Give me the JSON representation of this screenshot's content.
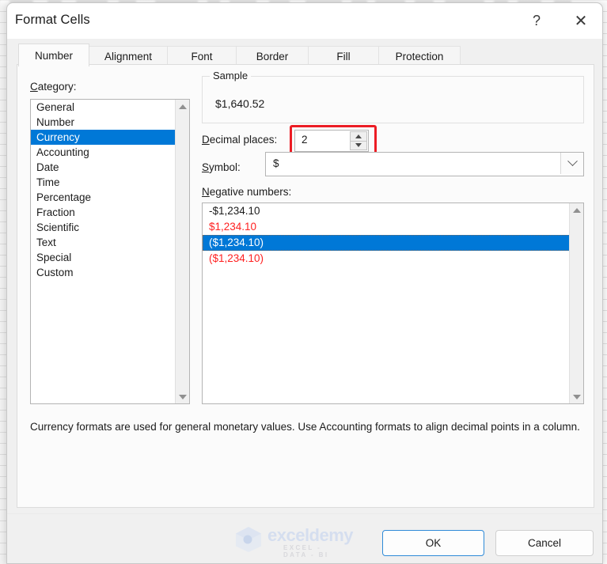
{
  "dialog": {
    "title": "Format Cells",
    "help_icon": "?",
    "close_icon": "✕"
  },
  "tabs": [
    {
      "label": "Number",
      "selected": true
    },
    {
      "label": "Alignment",
      "selected": false
    },
    {
      "label": "Font",
      "selected": false
    },
    {
      "label": "Border",
      "selected": false
    },
    {
      "label": "Fill",
      "selected": false
    },
    {
      "label": "Protection",
      "selected": false
    }
  ],
  "category": {
    "label": "Category:",
    "label_accel": "C",
    "items": [
      {
        "label": "General",
        "selected": false
      },
      {
        "label": "Number",
        "selected": false
      },
      {
        "label": "Currency",
        "selected": true
      },
      {
        "label": "Accounting",
        "selected": false
      },
      {
        "label": "Date",
        "selected": false
      },
      {
        "label": "Time",
        "selected": false
      },
      {
        "label": "Percentage",
        "selected": false
      },
      {
        "label": "Fraction",
        "selected": false
      },
      {
        "label": "Scientific",
        "selected": false
      },
      {
        "label": "Text",
        "selected": false
      },
      {
        "label": "Special",
        "selected": false
      },
      {
        "label": "Custom",
        "selected": false
      }
    ]
  },
  "sample": {
    "legend": "Sample",
    "value": "$1,640.52"
  },
  "decimal_places": {
    "label": "Decimal places:",
    "label_accel": "D",
    "value": "2",
    "highlight_color": "#ec1c24"
  },
  "symbol": {
    "label": "Symbol:",
    "label_accel": "S",
    "value": "$"
  },
  "negative_numbers": {
    "label": "Negative numbers:",
    "label_accel": "N",
    "items": [
      {
        "label": "-$1,234.10",
        "color": "#1b1b1b",
        "selected": false
      },
      {
        "label": "$1,234.10",
        "color": "#ff2020",
        "selected": false
      },
      {
        "label": "($1,234.10)",
        "color": "#1b1b1b",
        "selected": true
      },
      {
        "label": "($1,234.10)",
        "color": "#ff2020",
        "selected": false
      }
    ]
  },
  "description": "Currency formats are used for general monetary values.  Use Accounting formats to align decimal points in a column.",
  "footer": {
    "watermark_text": "exceldemy",
    "watermark_sub": "EXCEL - DATA - BI",
    "ok_label": "OK",
    "cancel_label": "Cancel"
  },
  "colors": {
    "selection_blue": "#0078d7",
    "focus_blue": "#2f8ad8",
    "negative_red": "#ff2020",
    "highlight_red": "#ec1c24"
  }
}
